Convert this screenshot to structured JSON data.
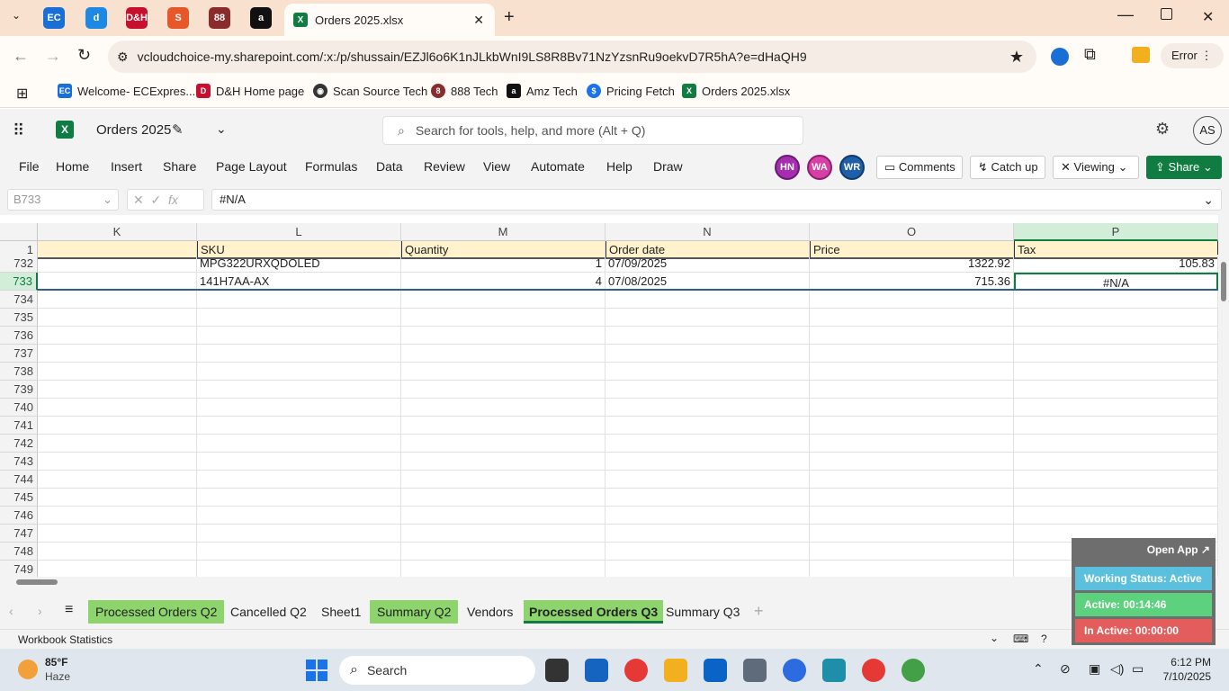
{
  "browser": {
    "active_tab_title": "Orders 2025.xlsx",
    "url": "vcloudchoice-my.sharepoint.com/:x:/p/shussain/EZJl6o6K1nJLkbWnI9LS8R8Bv71NzYzsnRu9oekvD7R5hA?e=dHaQH9",
    "error_label": "Error",
    "bookmarks": [
      {
        "label": "Welcome- ECExpres...",
        "color": "#1a6fd6",
        "icon": "EC"
      },
      {
        "label": "D&H Home page",
        "color": "#c8102e",
        "icon": "D&H"
      },
      {
        "label": "Scan Source Tech",
        "color": "#333333",
        "icon": "globe"
      },
      {
        "label": "888 Tech",
        "color": "#8b2c2c",
        "icon": "888"
      },
      {
        "label": "Amz Tech",
        "color": "#111111",
        "icon": "a"
      },
      {
        "label": "Pricing Fetch",
        "color": "#1a73e8",
        "icon": "$"
      },
      {
        "label": "Orders 2025.xlsx",
        "color": "#107c41",
        "icon": "X"
      }
    ]
  },
  "excel": {
    "doc_title": "Orders 2025",
    "search_placeholder": "Search for tools, help, and more (Alt + Q)",
    "user_initials": "AS",
    "menu": [
      "File",
      "Home",
      "Insert",
      "Share",
      "Page Layout",
      "Formulas",
      "Data",
      "Review",
      "View",
      "Automate",
      "Help",
      "Draw"
    ],
    "collaborators": [
      "HN",
      "WA",
      "WR"
    ],
    "comments_label": "Comments",
    "catchup_label": "Catch up",
    "viewing_label": "Viewing",
    "share_label": "Share",
    "name_box": "B733",
    "fx_label": "fx",
    "formula_value": "#N/A"
  },
  "sheet": {
    "columns": [
      "K",
      "L",
      "M",
      "N",
      "O",
      "P"
    ],
    "header_row": {
      "row": "1",
      "cells": [
        "",
        "SKU",
        "Quantity",
        "Order date",
        "Price",
        "Tax"
      ]
    },
    "data_rows": [
      {
        "row": "732",
        "cells": [
          "",
          "MPG322URXQDOLED",
          "1",
          "07/09/2025",
          "1322.92",
          "105.83"
        ]
      },
      {
        "row": "733",
        "cells": [
          "",
          "141H7AA-AX",
          "4",
          "07/08/2025",
          "715.36",
          "#N/A"
        ]
      }
    ],
    "empty_rows": [
      "734",
      "735",
      "736",
      "737",
      "738",
      "739",
      "740",
      "741",
      "742",
      "743",
      "744",
      "745",
      "746",
      "747",
      "748",
      "749"
    ]
  },
  "sheet_tabs": [
    {
      "label": "Processed Orders Q2",
      "green": true
    },
    {
      "label": "Cancelled Q2",
      "green": false
    },
    {
      "label": "Sheet1",
      "green": false
    },
    {
      "label": "Summary Q2",
      "green": true
    },
    {
      "label": "Vendors",
      "green": false
    },
    {
      "label": "Processed Orders Q3",
      "green": true
    },
    {
      "label": "Summary Q3",
      "green": false
    }
  ],
  "status": {
    "workbook_stats": "Workbook Statistics"
  },
  "tracker": {
    "open_app": "Open App ↗",
    "working_status": "Working Status: Active",
    "active": "Active: 00:14:46",
    "inactive": "In Active: 00:00:00",
    "colors": {
      "status": "#5bc0de",
      "active": "#5cd17e",
      "inactive": "#e35d5d"
    }
  },
  "taskbar": {
    "weather_temp": "85°F",
    "weather_desc": "Haze",
    "search_label": "Search",
    "time": "6:12 PM",
    "date": "7/10/2025"
  }
}
